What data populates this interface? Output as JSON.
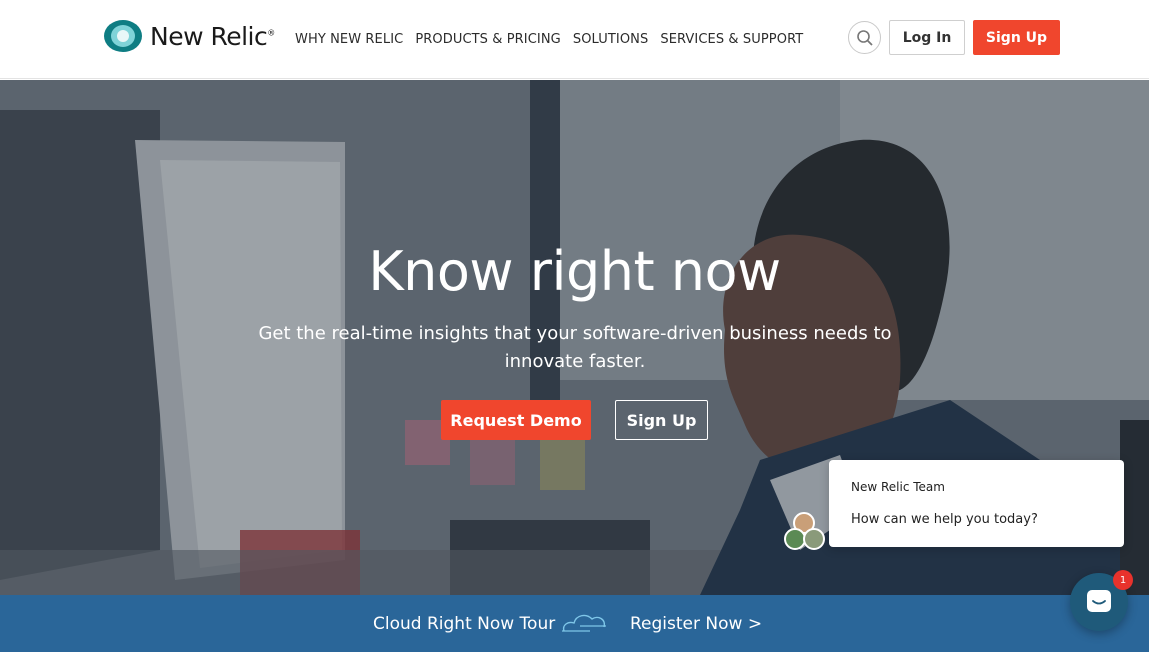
{
  "brand": {
    "name": "New Relic",
    "trademark": "®",
    "accent": "#f0462d",
    "logo_color": "#0e7d83"
  },
  "nav": {
    "items": [
      "WHY NEW RELIC",
      "PRODUCTS & PRICING",
      "SOLUTIONS",
      "SERVICES & SUPPORT"
    ]
  },
  "header": {
    "search_icon": "search-icon",
    "login_label": "Log In",
    "signup_label": "Sign Up"
  },
  "hero": {
    "title": "Know right now",
    "subtitle": "Get the real-time insights that your software-driven business needs to innovate faster.",
    "demo_label": "Request Demo",
    "signup_label": "Sign Up"
  },
  "chat": {
    "team": "New Relic Team",
    "message": "How can we help you today?",
    "badge_count": "1",
    "launcher_icon": "chat-bubble-icon"
  },
  "banner": {
    "tour": "Cloud Right Now Tour",
    "register": "Register Now >",
    "icon": "cloud-icon",
    "color": "#2a6699"
  }
}
